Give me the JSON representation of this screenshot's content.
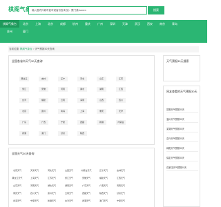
{
  "header": {
    "logo": "棋阁气象台",
    "search_placeholder": "输入国内外城市如市或省份查询 如：厦门或xiamen",
    "search_button": "搜索"
  },
  "nav": {
    "row1": [
      "棋阁气象台",
      "北京",
      "上海",
      "北京",
      "成都",
      "杭州",
      "重庆",
      "广州",
      "深圳",
      "天津",
      "武汉",
      "西安",
      "南京",
      "青岛"
    ],
    "row2": [
      "苏州",
      "厦门"
    ]
  },
  "breadcrumb": {
    "home": "当前位置:",
    "site": "棋阁气象台",
    "sep": ">",
    "current": "天气预报30天查询"
  },
  "main_panel": {
    "title": "全国各省市天气30天查询",
    "provinces": [
      [
        "黑龙江",
        "吉林",
        "辽宁",
        "河北",
        "山东",
        "江苏"
      ],
      [
        "浙江",
        "安徽",
        "河南",
        "湖北",
        "湖南",
        "江西"
      ],
      [
        "台湾",
        "福建",
        "云南",
        "海南",
        "山西",
        "四川"
      ],
      [
        "北京",
        "贵州",
        "青海",
        "上海",
        "重庆",
        "天津"
      ],
      [
        "广东",
        "广西",
        "宁夏",
        "西藏",
        "新疆",
        "内蒙古"
      ],
      [
        "香港",
        "澳门",
        "甘肃",
        "陕西"
      ]
    ]
  },
  "city_panel": {
    "title": "全国天气30天查询",
    "cities": [
      [
        "北京天气",
        "天津天气",
        "河北天气",
        "山西天气",
        "内蒙古天气",
        "辽宁天气",
        "吉林天气"
      ],
      [
        "黑龙江天气",
        "上海天气",
        "江苏天气",
        "浙江天气",
        "安徽天气",
        "福建天气",
        "江西天气"
      ],
      [
        "山东天气",
        "河南天气",
        "湖北天气",
        "湖南天气",
        "广东天气",
        "广西天气",
        "海南天气"
      ],
      [
        "重庆天气",
        "四川天气",
        "贵州天气",
        "云南天气",
        "西藏天气",
        "陕西天气",
        "甘肃天气"
      ],
      [
        "青海天气",
        "宁夏天气",
        "新疆天气",
        "台湾天气",
        "香港天气",
        "澳门天气",
        "宁夏天气"
      ]
    ]
  },
  "side_panel": {
    "title1": "天气预报30天搜索",
    "title2": "网友查看的天气预报30天",
    "items": [
      "昆明天气预报30天",
      "温州天气预报30天",
      "芜湖天气预报30天",
      "嘉兴天气预报30天",
      "绵阳天气预报30天",
      "保定天气预报30天",
      "石家庄天气预报30天"
    ]
  }
}
